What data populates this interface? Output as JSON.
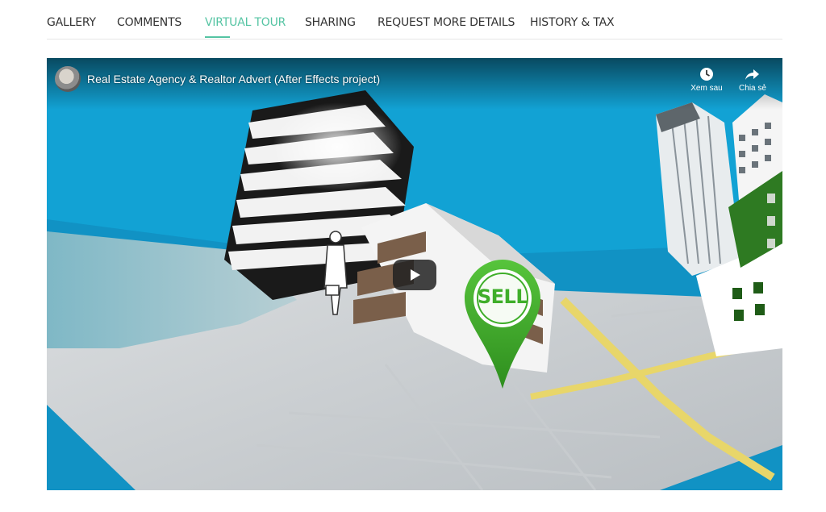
{
  "tabs": [
    {
      "label": "GALLERY",
      "active": false
    },
    {
      "label": "COMMENTS",
      "active": false
    },
    {
      "label": "VIRTUAL TOUR",
      "active": true
    },
    {
      "label": "SHARING",
      "active": false
    },
    {
      "label": "REQUEST MORE DETAILS",
      "active": false
    },
    {
      "label": "HISTORY & TAX",
      "active": false
    }
  ],
  "video": {
    "title": "Real Estate Agency & Realtor Advert (After Effects project)",
    "watch_later_label": "Xem sau",
    "share_label": "Chia sẻ",
    "sign_text": "SELL",
    "icons": {
      "watch_later": "clock-icon",
      "share": "share-arrow-icon",
      "play": "play-icon"
    }
  },
  "colors": {
    "accent": "#55c4a3",
    "tab_text": "#333333",
    "sky": "#12a2d4",
    "pin_green": "#3fae2a"
  }
}
